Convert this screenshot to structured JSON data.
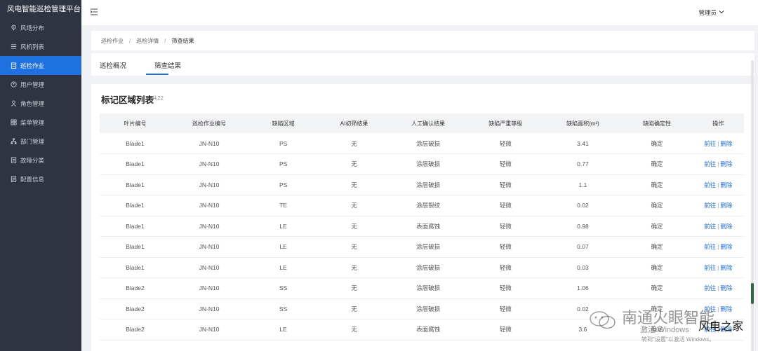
{
  "app": {
    "title": "风电智能巡检管理平台"
  },
  "sidebar": {
    "items": [
      {
        "label": "风场分布",
        "icon": "location-icon"
      },
      {
        "label": "风机列表",
        "icon": "list-icon"
      },
      {
        "label": "巡检作业",
        "icon": "clipboard-icon",
        "active": true
      },
      {
        "label": "用户管理",
        "icon": "user-circle-icon"
      },
      {
        "label": "角色管理",
        "icon": "person-icon"
      },
      {
        "label": "菜单管理",
        "icon": "grid-icon"
      },
      {
        "label": "部门管理",
        "icon": "org-icon"
      },
      {
        "label": "故障分类",
        "icon": "document-icon"
      },
      {
        "label": "配置信息",
        "icon": "settings-doc-icon"
      }
    ]
  },
  "header": {
    "user": "管理员"
  },
  "breadcrumb": {
    "items": [
      "巡检作业",
      "巡检详情",
      "筛查结果"
    ]
  },
  "tabs": [
    {
      "label": "巡检概况"
    },
    {
      "label": "筛查结果",
      "active": true
    }
  ],
  "list": {
    "title": "标记区域列表",
    "count": "共22",
    "columns": [
      "叶片编号",
      "巡检作业编号",
      "缺陷区域",
      "AI初筛结果",
      "人工确认结果",
      "缺陷严重等级",
      "缺陷面积(m²)",
      "缺陷确定性",
      "操作"
    ],
    "rows": [
      [
        "Blade1",
        "JN-N10",
        "PS",
        "无",
        "涂层破损",
        "轻微",
        "3.41",
        "确定"
      ],
      [
        "Blade1",
        "JN-N10",
        "PS",
        "无",
        "涂层破损",
        "轻微",
        "0.77",
        "确定"
      ],
      [
        "Blade1",
        "JN-N10",
        "PS",
        "无",
        "涂层破损",
        "轻微",
        "1.1",
        "确定"
      ],
      [
        "Blade1",
        "JN-N10",
        "TE",
        "无",
        "涂层裂纹",
        "轻微",
        "0.02",
        "确定"
      ],
      [
        "Blade1",
        "JN-N10",
        "LE",
        "无",
        "表面腐蚀",
        "轻微",
        "0.98",
        "确定"
      ],
      [
        "Blade1",
        "JN-N10",
        "LE",
        "无",
        "涂层破损",
        "轻微",
        "0.07",
        "确定"
      ],
      [
        "Blade1",
        "JN-N10",
        "LE",
        "无",
        "涂层破损",
        "轻微",
        "0.03",
        "确定"
      ],
      [
        "Blade2",
        "JN-N10",
        "SS",
        "无",
        "涂层破损",
        "轻微",
        "1.06",
        "确定"
      ],
      [
        "Blade2",
        "JN-N10",
        "SS",
        "无",
        "涂层破损",
        "轻微",
        "0.02",
        "确定"
      ],
      [
        "Blade2",
        "JN-N10",
        "LE",
        "无",
        "表面腐蚀",
        "轻微",
        "3.6",
        "确定"
      ]
    ],
    "actions": {
      "go": "前往",
      "sep": "|",
      "delete": "删除"
    }
  },
  "watermark": {
    "text": "南通火眼智能",
    "sub": "风电之家",
    "windows_line1": "激活 Windows",
    "windows_line2": "转到\"设置\"以激活 Windows。"
  },
  "colors": {
    "accent": "#1f70e0",
    "sidebar": "#2e3441"
  }
}
